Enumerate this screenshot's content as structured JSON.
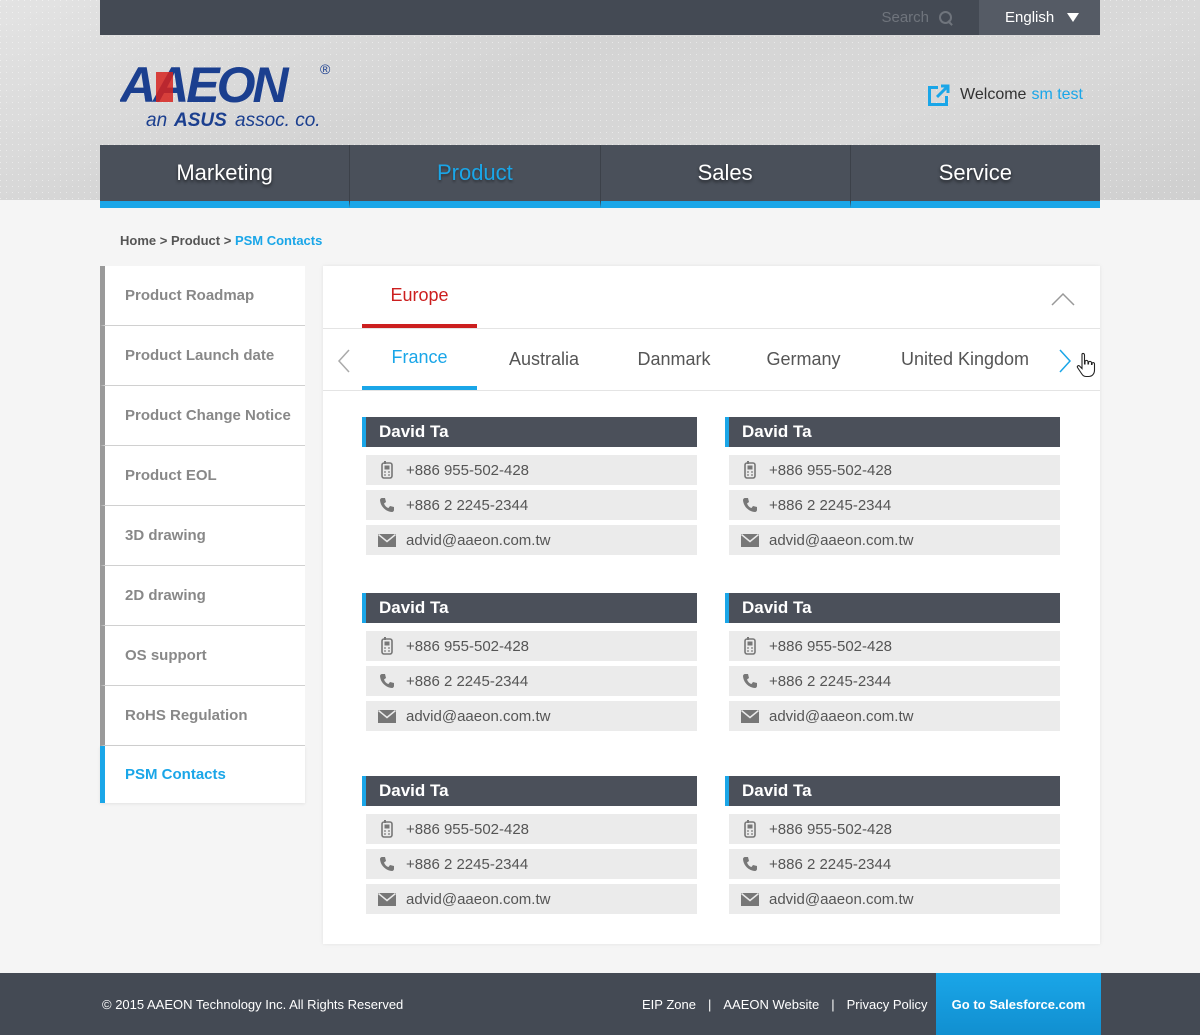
{
  "header": {
    "search_placeholder": "Search",
    "language": "English",
    "welcome_label": "Welcome",
    "user_name": "sm test",
    "logo_text": "AAEON",
    "logo_sub_prefix": "an",
    "logo_sub_brand": "ASUS",
    "logo_sub_suffix": "assoc. co.",
    "logo_registered": "®"
  },
  "nav": {
    "items": [
      {
        "label": "Marketing"
      },
      {
        "label": "Product"
      },
      {
        "label": "Sales"
      },
      {
        "label": "Service"
      }
    ],
    "active": "Product"
  },
  "breadcrumb": {
    "home": "Home",
    "sep": ">",
    "product": "Product",
    "current": "PSM Contacts"
  },
  "sidebar": {
    "items": [
      {
        "label": "Product Roadmap"
      },
      {
        "label": "Product Launch date"
      },
      {
        "label": "Product Change Notice"
      },
      {
        "label": "Product EOL"
      },
      {
        "label": "3D drawing"
      },
      {
        "label": "2D drawing"
      },
      {
        "label": "OS support"
      },
      {
        "label": "RoHS  Regulation"
      },
      {
        "label": "PSM Contacts"
      }
    ],
    "active": "PSM Contacts"
  },
  "content": {
    "region": "Europe",
    "countries": [
      {
        "label": "France"
      },
      {
        "label": "Australia"
      },
      {
        "label": "Danmark"
      },
      {
        "label": "Germany"
      },
      {
        "label": "United Kingdom"
      }
    ],
    "active_country": "France",
    "contacts": [
      {
        "name": "David Ta",
        "mobile": "+886 955-502-428",
        "phone": "+886 2 2245-2344",
        "email": "advid@aaeon.com.tw"
      },
      {
        "name": "David Ta",
        "mobile": "+886 955-502-428",
        "phone": "+886 2 2245-2344",
        "email": "advid@aaeon.com.tw"
      },
      {
        "name": "David Ta",
        "mobile": "+886 955-502-428",
        "phone": "+886 2 2245-2344",
        "email": "advid@aaeon.com.tw"
      },
      {
        "name": "David Ta",
        "mobile": "+886 955-502-428",
        "phone": "+886 2 2245-2344",
        "email": "advid@aaeon.com.tw"
      },
      {
        "name": "David Ta",
        "mobile": "+886 955-502-428",
        "phone": "+886 2 2245-2344",
        "email": "advid@aaeon.com.tw"
      },
      {
        "name": "David Ta",
        "mobile": "+886 955-502-428",
        "phone": "+886 2 2245-2344",
        "email": "advid@aaeon.com.tw"
      }
    ]
  },
  "footer": {
    "copyright": "© 2015 AAEON Technology Inc. All Rights Reserved",
    "links": [
      {
        "label": "EIP Zone"
      },
      {
        "label": "AAEON Website"
      },
      {
        "label": "Privacy Policy"
      }
    ],
    "link_sep": "|",
    "salesforce": "Go to Salesforce.com"
  },
  "colors": {
    "accent": "#1aa6e8",
    "region_red": "#cc1f1f",
    "dark_bar": "#444a54"
  },
  "icons": [
    "search-icon",
    "dropdown-arrow-icon",
    "external-link-icon",
    "chevron-up-icon",
    "chevron-left-icon",
    "chevron-right-icon",
    "pointer-cursor-icon",
    "mobile-phone-icon",
    "phone-icon",
    "mail-icon"
  ]
}
